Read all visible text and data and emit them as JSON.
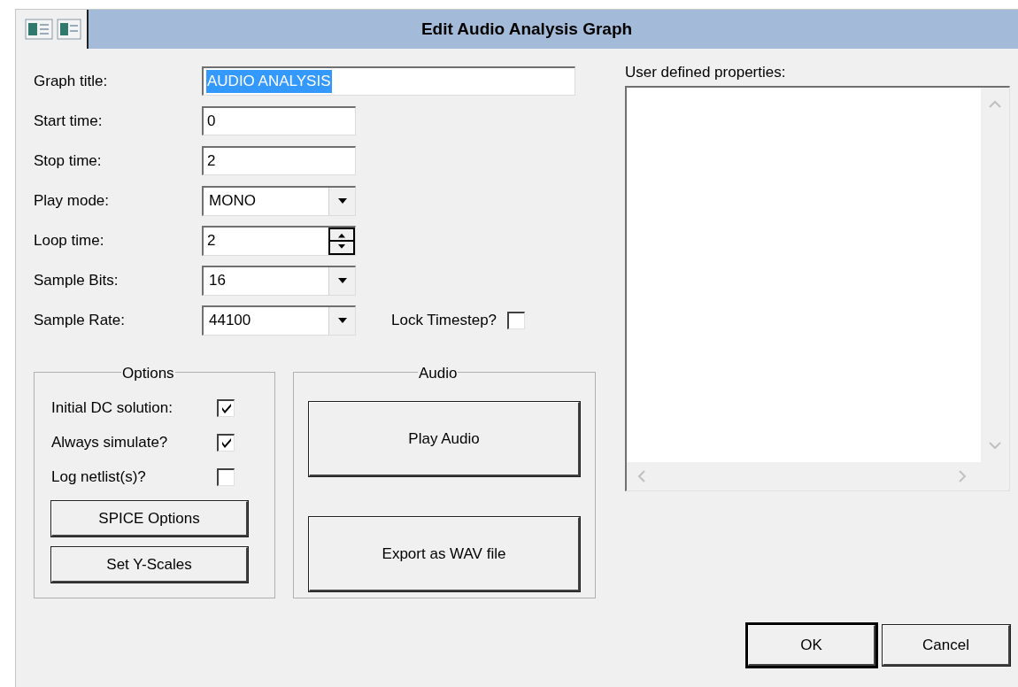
{
  "window": {
    "title": "Edit Audio Analysis Graph"
  },
  "fields": [
    {
      "label": "Graph title:",
      "kind": "text",
      "value": "AUDIO ANALYSIS",
      "text_selected": true
    },
    {
      "label": "Start time:",
      "kind": "text",
      "value": "0",
      "text_selected": false
    },
    {
      "label": "Stop time:",
      "kind": "text",
      "value": "2",
      "text_selected": false
    },
    {
      "label": "Play mode:",
      "kind": "combo",
      "value": "MONO",
      "text_selected": false
    },
    {
      "label": "Loop time:",
      "kind": "spin",
      "value": "2",
      "text_selected": false
    },
    {
      "label": "Sample Bits:",
      "kind": "combo",
      "value": "16",
      "text_selected": false
    },
    {
      "label": "Sample Rate:",
      "kind": "combo",
      "value": "44100",
      "text_selected": false
    }
  ],
  "lock_timestep": {
    "label": "Lock Timestep?",
    "checked": false
  },
  "options": {
    "title": "Options",
    "checkboxes": [
      {
        "label": "Initial DC solution:",
        "checked": true
      },
      {
        "label": "Always simulate?",
        "checked": true
      },
      {
        "label": "Log netlist(s)?",
        "checked": false
      }
    ],
    "buttons": [
      {
        "label": "SPICE Options"
      },
      {
        "label": "Set Y-Scales"
      }
    ]
  },
  "audio": {
    "title": "Audio",
    "buttons": [
      {
        "label": "Play Audio"
      },
      {
        "label": "Export as WAV file"
      }
    ]
  },
  "properties": {
    "label": "User defined properties:"
  },
  "buttons": [
    {
      "label": "OK",
      "default": true
    },
    {
      "label": "Cancel",
      "default": false
    }
  ]
}
